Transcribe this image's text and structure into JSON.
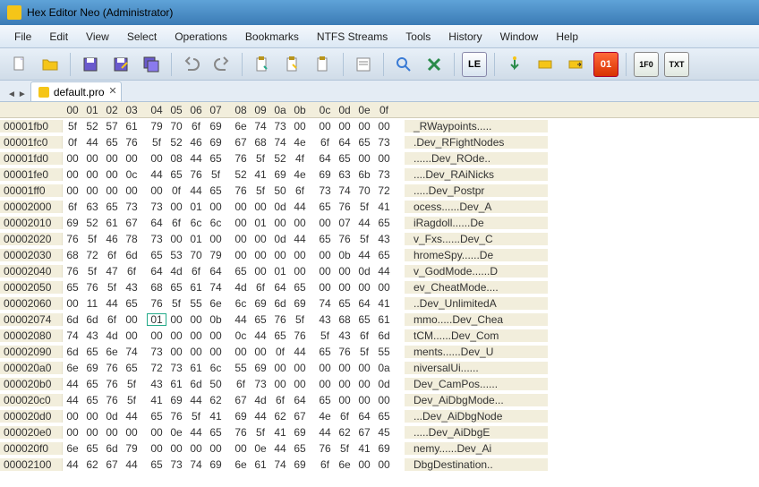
{
  "title": "Hex Editor Neo (Administrator)",
  "menu": [
    "File",
    "Edit",
    "View",
    "Select",
    "Operations",
    "Bookmarks",
    "NTFS Streams",
    "Tools",
    "History",
    "Window",
    "Help"
  ],
  "toolbar": {
    "le": "LE",
    "zo": "01",
    "f0": "1F0",
    "txt": "TXT"
  },
  "tab": {
    "name": "default.pro"
  },
  "header": [
    "00",
    "01",
    "02",
    "03",
    "04",
    "05",
    "06",
    "07",
    "08",
    "09",
    "0a",
    "0b",
    "0c",
    "0d",
    "0e",
    "0f"
  ],
  "cursor": {
    "row": 10,
    "col": 4
  },
  "rows": [
    {
      "addr": "00001fb0",
      "bytes": [
        "5f",
        "52",
        "57",
        "61",
        "79",
        "70",
        "6f",
        "69",
        "6e",
        "74",
        "73",
        "00",
        "00",
        "00",
        "00",
        "00"
      ],
      "ascii": "_RWaypoints....."
    },
    {
      "addr": "00001fc0",
      "bytes": [
        "0f",
        "44",
        "65",
        "76",
        "5f",
        "52",
        "46",
        "69",
        "67",
        "68",
        "74",
        "4e",
        "6f",
        "64",
        "65",
        "73"
      ],
      "ascii": ".Dev_RFightNodes"
    },
    {
      "addr": "00001fd0",
      "bytes": [
        "00",
        "00",
        "00",
        "00",
        "00",
        "08",
        "44",
        "65",
        "76",
        "5f",
        "52",
        "4f",
        "64",
        "65",
        "00",
        "00"
      ],
      "ascii": "......Dev_ROde.."
    },
    {
      "addr": "00001fe0",
      "bytes": [
        "00",
        "00",
        "00",
        "0c",
        "44",
        "65",
        "76",
        "5f",
        "52",
        "41",
        "69",
        "4e",
        "69",
        "63",
        "6b",
        "73"
      ],
      "ascii": "....Dev_RAiNicks"
    },
    {
      "addr": "00001ff0",
      "bytes": [
        "00",
        "00",
        "00",
        "00",
        "00",
        "0f",
        "44",
        "65",
        "76",
        "5f",
        "50",
        "6f",
        "73",
        "74",
        "70",
        "72"
      ],
      "ascii": ".....Dev_Postpr"
    },
    {
      "addr": "00002000",
      "bytes": [
        "6f",
        "63",
        "65",
        "73",
        "73",
        "00",
        "01",
        "00",
        "00",
        "00",
        "0d",
        "44",
        "65",
        "76",
        "5f",
        "41"
      ],
      "ascii": "ocess......Dev_A"
    },
    {
      "addr": "00002010",
      "bytes": [
        "69",
        "52",
        "61",
        "67",
        "64",
        "6f",
        "6c",
        "6c",
        "00",
        "01",
        "00",
        "00",
        "00",
        "07",
        "44",
        "65"
      ],
      "ascii": "iRagdoll......De"
    },
    {
      "addr": "00002020",
      "bytes": [
        "76",
        "5f",
        "46",
        "78",
        "73",
        "00",
        "01",
        "00",
        "00",
        "00",
        "0d",
        "44",
        "65",
        "76",
        "5f",
        "43"
      ],
      "ascii": "v_Fxs......Dev_C"
    },
    {
      "addr": "00002030",
      "bytes": [
        "68",
        "72",
        "6f",
        "6d",
        "65",
        "53",
        "70",
        "79",
        "00",
        "00",
        "00",
        "00",
        "00",
        "0b",
        "44",
        "65"
      ],
      "ascii": "hromeSpy......De"
    },
    {
      "addr": "00002040",
      "bytes": [
        "76",
        "5f",
        "47",
        "6f",
        "64",
        "4d",
        "6f",
        "64",
        "65",
        "00",
        "01",
        "00",
        "00",
        "00",
        "0d",
        "44"
      ],
      "ascii": "v_GodMode......D"
    },
    {
      "addr": "00002050",
      "bytes": [
        "65",
        "76",
        "5f",
        "43",
        "68",
        "65",
        "61",
        "74",
        "4d",
        "6f",
        "64",
        "65",
        "00",
        "00",
        "00",
        "00"
      ],
      "ascii": "ev_CheatMode...."
    },
    {
      "addr": "00002060",
      "bytes": [
        "00",
        "11",
        "44",
        "65",
        "76",
        "5f",
        "55",
        "6e",
        "6c",
        "69",
        "6d",
        "69",
        "74",
        "65",
        "64",
        "41"
      ],
      "ascii": "..Dev_UnlimitedA"
    },
    {
      "addr": "00002074",
      "bytes": [
        "6d",
        "6d",
        "6f",
        "00",
        "01",
        "00",
        "00",
        "0b",
        "44",
        "65",
        "76",
        "5f",
        "43",
        "68",
        "65",
        "61"
      ],
      "ascii": "mmo.....Dev_Chea"
    },
    {
      "addr": "00002080",
      "bytes": [
        "74",
        "43",
        "4d",
        "00",
        "00",
        "00",
        "00",
        "00",
        "0c",
        "44",
        "65",
        "76",
        "5f",
        "43",
        "6f",
        "6d"
      ],
      "ascii": "tCM......Dev_Com"
    },
    {
      "addr": "00002090",
      "bytes": [
        "6d",
        "65",
        "6e",
        "74",
        "73",
        "00",
        "00",
        "00",
        "00",
        "00",
        "0f",
        "44",
        "65",
        "76",
        "5f",
        "55"
      ],
      "ascii": "ments......Dev_U"
    },
    {
      "addr": "000020a0",
      "bytes": [
        "6e",
        "69",
        "76",
        "65",
        "72",
        "73",
        "61",
        "6c",
        "55",
        "69",
        "00",
        "00",
        "00",
        "00",
        "00",
        "0a"
      ],
      "ascii": "niversalUi......"
    },
    {
      "addr": "000020b0",
      "bytes": [
        "44",
        "65",
        "76",
        "5f",
        "43",
        "61",
        "6d",
        "50",
        "6f",
        "73",
        "00",
        "00",
        "00",
        "00",
        "00",
        "0d"
      ],
      "ascii": "Dev_CamPos......"
    },
    {
      "addr": "000020c0",
      "bytes": [
        "44",
        "65",
        "76",
        "5f",
        "41",
        "69",
        "44",
        "62",
        "67",
        "4d",
        "6f",
        "64",
        "65",
        "00",
        "00",
        "00"
      ],
      "ascii": "Dev_AiDbgMode..."
    },
    {
      "addr": "000020d0",
      "bytes": [
        "00",
        "00",
        "0d",
        "44",
        "65",
        "76",
        "5f",
        "41",
        "69",
        "44",
        "62",
        "67",
        "4e",
        "6f",
        "64",
        "65"
      ],
      "ascii": "...Dev_AiDbgNode"
    },
    {
      "addr": "000020e0",
      "bytes": [
        "00",
        "00",
        "00",
        "00",
        "00",
        "0e",
        "44",
        "65",
        "76",
        "5f",
        "41",
        "69",
        "44",
        "62",
        "67",
        "45"
      ],
      "ascii": ".....Dev_AiDbgE"
    },
    {
      "addr": "000020f0",
      "bytes": [
        "6e",
        "65",
        "6d",
        "79",
        "00",
        "00",
        "00",
        "00",
        "00",
        "0e",
        "44",
        "65",
        "76",
        "5f",
        "41",
        "69"
      ],
      "ascii": "nemy......Dev_Ai"
    },
    {
      "addr": "00002100",
      "bytes": [
        "44",
        "62",
        "67",
        "44",
        "65",
        "73",
        "74",
        "69",
        "6e",
        "61",
        "74",
        "69",
        "6f",
        "6e",
        "00",
        "00"
      ],
      "ascii": "DbgDestination.."
    }
  ]
}
